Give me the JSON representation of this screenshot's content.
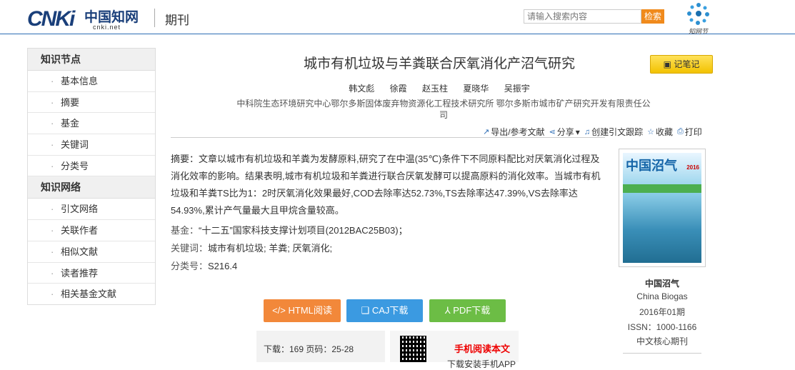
{
  "header": {
    "logo_main": "CNKi",
    "logo_cn": "中国知网",
    "logo_url_text": "cnki.net",
    "section": "期刊",
    "search_placeholder": "请输入搜索内容",
    "search_button": "检索",
    "zhiwang_label": "知网节"
  },
  "sidebar": {
    "groups": [
      {
        "title": "知识节点",
        "items": [
          "基本信息",
          "摘要",
          "基金",
          "关键词",
          "分类号"
        ]
      },
      {
        "title": "知识网络",
        "items": [
          "引文网络",
          "关联作者",
          "相似文献",
          "读者推荐",
          "相关基金文献"
        ]
      }
    ]
  },
  "article": {
    "title": "城市有机垃圾与羊粪联合厌氧消化产沼气研究",
    "note_button": "记笔记",
    "authors": [
      "韩文彪",
      "徐霞",
      "赵玉柱",
      "夏晓华",
      "吴振宇"
    ],
    "orgs": "中科院生态环境研究中心鄂尔多斯固体废弃物资源化工程技术研究所   鄂尔多斯市城市矿产研究开发有限责任公司",
    "abstract_label": "摘要：",
    "abstract": "文章以城市有机垃圾和羊粪为发酵原料,研究了在中温(35℃)条件下不同原料配比对厌氧消化过程及消化效率的影响。结果表明,城市有机垃圾和羊粪进行联合厌氧发酵可以提高原料的消化效率。当城市有机垃圾和羊粪TS比为1：2时厌氧消化效果最好,COD去除率达52.73%,TS去除率达47.39%,VS去除率达54.93%,累计产气量最大且甲烷含量较高。",
    "fund_label": "基金：",
    "fund": "“十二五”国家科技支撑计划项目(2012BAC25B03)；",
    "keywords_label": "关键词：",
    "keywords": "城市有机垃圾; 羊粪; 厌氧消化;",
    "class_label": "分类号：",
    "class": "S216.4"
  },
  "tools": {
    "export": "导出/参考文献",
    "share": "分享",
    "cite_track": "创建引文跟踪",
    "favorite": "收藏",
    "print": "打印"
  },
  "downloads": {
    "html": "HTML阅读",
    "caj": "CAJ下载",
    "pdf": "PDF下载",
    "stats": "下载：169  页码：25-28",
    "mobile": "手机阅读本文",
    "mobile_sub": "下载安装手机APP"
  },
  "journal": {
    "cover_title": "中国沼气",
    "cover_year": "2016",
    "name": "中国沼气",
    "name_en": "China Biogas",
    "issue": "2016年01期",
    "issn": "ISSN：1000-1166",
    "core": "中文核心期刊"
  }
}
